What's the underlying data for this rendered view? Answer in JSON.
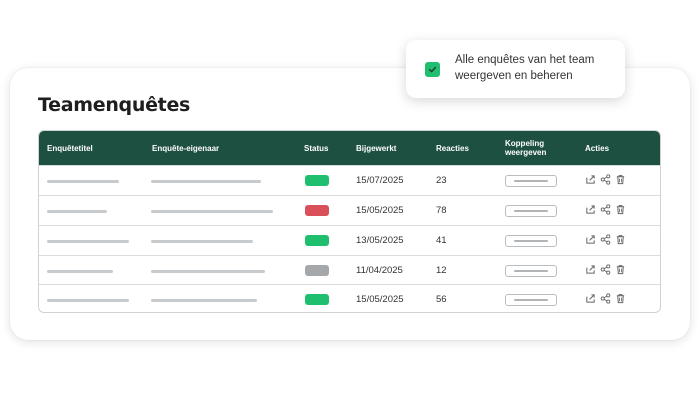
{
  "page": {
    "title": "Teamenquêtes"
  },
  "popup": {
    "text": "Alle enquêtes van het team weergeven en beheren",
    "checked": true,
    "accent": "#1fbf6f"
  },
  "table": {
    "header_bg": "#1e5041",
    "columns": {
      "title": "Enquêtetitel",
      "owner": "Enquête-eigenaar",
      "status": "Status",
      "updated": "Bijgewerkt",
      "responses": "Reacties",
      "link": "Koppeling weergeven",
      "actions": "Acties"
    },
    "rows": [
      {
        "status": "green",
        "status_color": "#1fbf6f",
        "updated": "15/07/2025",
        "responses": "23"
      },
      {
        "status": "red",
        "status_color": "#d9505a",
        "updated": "15/05/2025",
        "responses": "78"
      },
      {
        "status": "green",
        "status_color": "#1fbf6f",
        "updated": "13/05/2025",
        "responses": "41"
      },
      {
        "status": "gray",
        "status_color": "#a5a8aa",
        "updated": "11/04/2025",
        "responses": "12"
      },
      {
        "status": "green",
        "status_color": "#1fbf6f",
        "updated": "15/05/2025",
        "responses": "56"
      }
    ],
    "action_icons": [
      "export-icon",
      "share-icon",
      "trash-icon"
    ]
  }
}
